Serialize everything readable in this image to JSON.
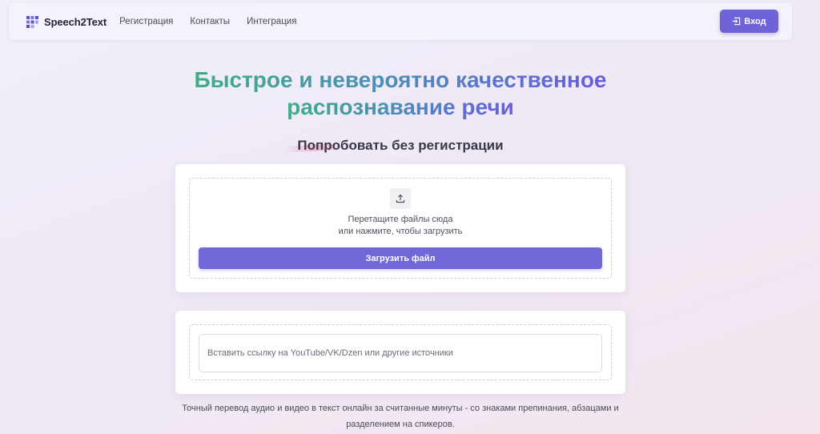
{
  "nav": {
    "logo_text": "Speech2Text",
    "links": [
      "Регистрация",
      "Контакты",
      "Интеграция"
    ],
    "login_label": "Вход"
  },
  "hero": {
    "line1": "Быстрое и невероятно качественное",
    "line2": "распознавание речи"
  },
  "subtitle": "Попробовать без регистрации",
  "upload": {
    "icon": "upload-icon",
    "drop_line1": "Перетащите файлы сюда",
    "drop_line2": "или нажмите, чтобы загрузить",
    "button_label": "Загрузить файл"
  },
  "link": {
    "placeholder": "Вставить ссылку на YouTube/VK/Dzen или другие источники",
    "value": ""
  },
  "footer": {
    "line1": "Точный перевод аудио и видео в текст онлайн за считанные минуты - со знаками препинания, абзацами и",
    "line2": "разделением на спикеров."
  },
  "colors": {
    "accent": "#6e63d9",
    "gradient_start": "#3fae86",
    "gradient_end": "#6a5ce0"
  }
}
